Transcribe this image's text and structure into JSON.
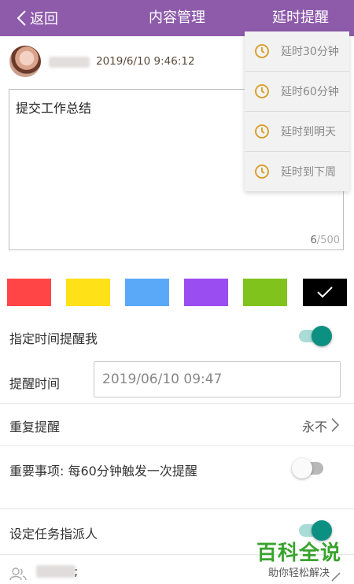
{
  "header": {
    "back_label": "返回",
    "title": "内容管理",
    "delay_button_label": "延时提醒",
    "bar_color": "#8e5bab"
  },
  "post": {
    "timestamp": "2019/6/10 9:46:12",
    "content": "提交工作总结",
    "char_count_current": "6",
    "char_count_max": "/500"
  },
  "colors": {
    "swatches": [
      "#ff4545",
      "#ffe117",
      "#5aa8f8",
      "#9a4df0",
      "#7fc31c",
      "#000000"
    ],
    "selected_index": 5
  },
  "remind_me": {
    "label": "指定时间提醒我",
    "enabled": true
  },
  "remind_time": {
    "label": "提醒时间",
    "value": "2019/06/10 09:47"
  },
  "repeat": {
    "label": "重复提醒",
    "value": "永不"
  },
  "important": {
    "label": "重要事项:  每60分钟触发一次提醒",
    "enabled": false
  },
  "assignee": {
    "label": "设定任务指派人",
    "enabled": true,
    "separator": ";"
  },
  "delay_menu": {
    "items": [
      "延时30分钟",
      "延时60分钟",
      "延时到明天",
      "延时到下周"
    ]
  },
  "watermark": {
    "title": "百科全说",
    "subtitle": "助你轻松解决"
  },
  "icons": {
    "back": "chevron-left-icon",
    "clock": "clock-icon",
    "check": "check-icon",
    "chevron": "chevron-right-icon",
    "people": "people-icon",
    "edit": "edit-icon"
  }
}
